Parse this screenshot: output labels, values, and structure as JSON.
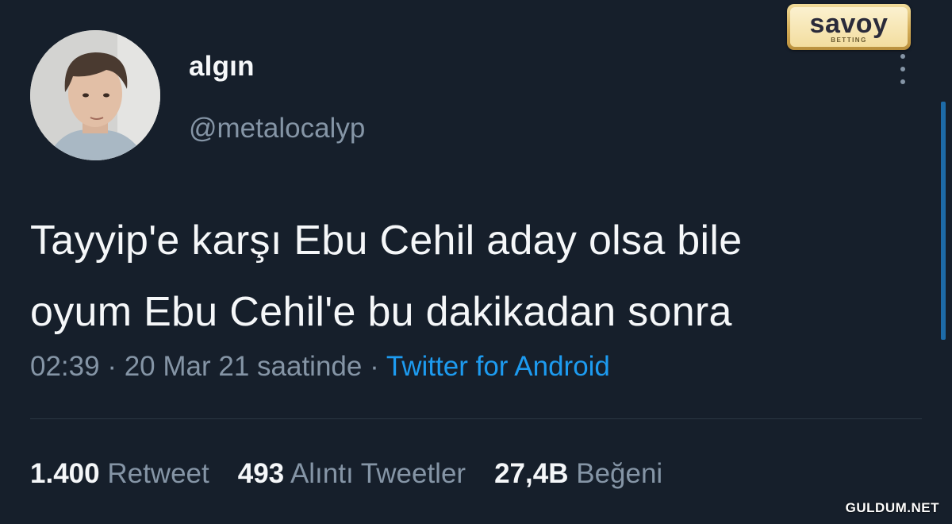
{
  "logo": {
    "word": "savoy",
    "sub": "BETTING"
  },
  "profile": {
    "display_name": "algın",
    "handle": "@metalocalyp"
  },
  "tweet": {
    "lines": [
      "Tayyip'e karşı Ebu Cehil aday olsa bile",
      "oyum Ebu Cehil'e bu dakikadan sonra"
    ],
    "time": "02:39",
    "separator": " · ",
    "date": "20 Mar 21 saatinde",
    "source": "Twitter for Android"
  },
  "stats": [
    {
      "count": "1.400",
      "label": "Retweet"
    },
    {
      "count": "493",
      "label": "Alıntı Tweetler"
    },
    {
      "count": "27,4B",
      "label": "Beğeni"
    }
  ],
  "watermark": "GULDUM.NET",
  "icons": {
    "more": "more-vertical-icon"
  },
  "colors": {
    "background": "#161f2b",
    "text": "#f5f7f9",
    "secondary": "#8595a6",
    "link": "#1d9bf0"
  }
}
